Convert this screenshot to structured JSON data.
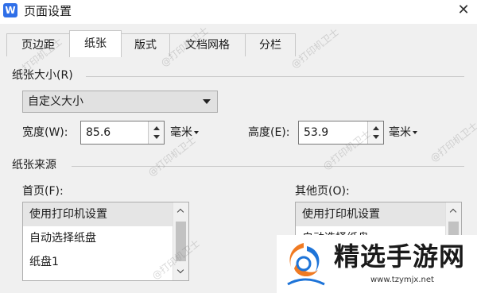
{
  "window": {
    "icon_letter": "W",
    "title": "页面设置",
    "close_glyph": "✕"
  },
  "tabs": [
    {
      "label": "页边距"
    },
    {
      "label": "纸张"
    },
    {
      "label": "版式"
    },
    {
      "label": "文档网格"
    },
    {
      "label": "分栏"
    }
  ],
  "paper_size": {
    "section_label": "纸张大小(R)",
    "selected": "自定义大小",
    "width_label": "宽度(W):",
    "width_value": "85.6",
    "width_unit": "毫米",
    "height_label": "高度(E):",
    "height_value": "53.9",
    "height_unit": "毫米"
  },
  "paper_source": {
    "section_label": "纸张来源",
    "first_page_label": "首页(F):",
    "first_page_items": [
      "使用打印机设置",
      "自动选择纸盘",
      "纸盘1"
    ],
    "other_pages_label": "其他页(O):",
    "other_pages_items": [
      "使用打印机设置",
      "自动选择纸盘"
    ]
  },
  "watermark_text": "@打印机卫士",
  "promo": {
    "name": "精选手游网",
    "url": "www.tzymjx.net"
  },
  "colors": {
    "app_icon": "#2f6fe8",
    "logo_orange": "#f07a22",
    "logo_blue": "#1e74d8"
  }
}
